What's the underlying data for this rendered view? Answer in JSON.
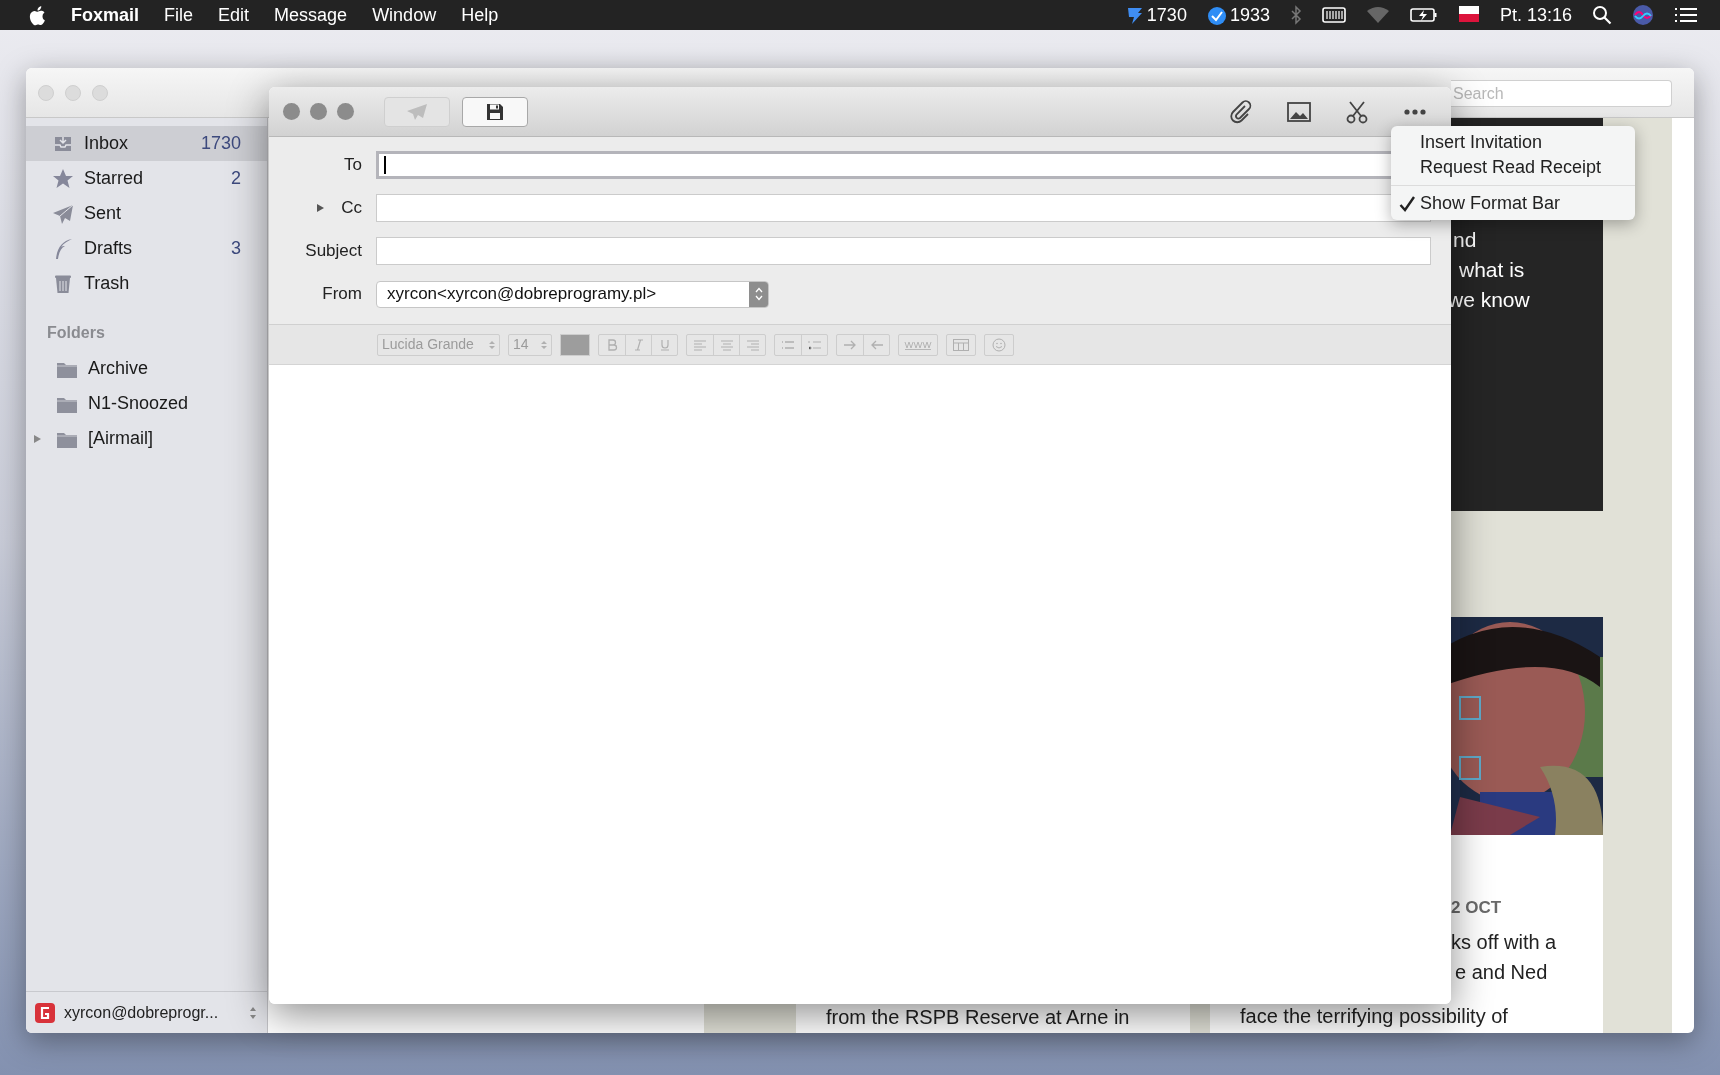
{
  "menu_bar": {
    "app": "Foxmail",
    "menus": [
      "File",
      "Edit",
      "Message",
      "Window",
      "Help"
    ],
    "counters": [
      "1730",
      "1933"
    ],
    "clock": "Pt. 13:16"
  },
  "main_window": {
    "search": {
      "placeholder": "Search"
    },
    "sidebar": {
      "mailboxes": [
        {
          "kind": "inbox",
          "label": "Inbox",
          "count": "1730",
          "selected": true
        },
        {
          "kind": "starred",
          "label": "Starred",
          "count": "2",
          "selected": false
        },
        {
          "kind": "sent",
          "label": "Sent",
          "selected": false
        },
        {
          "kind": "drafts",
          "label": "Drafts",
          "count": "3",
          "selected": false
        },
        {
          "kind": "trash",
          "label": "Trash",
          "selected": false
        }
      ],
      "folders_heading": "Folders",
      "folders": [
        {
          "label": "Archive",
          "expandable": false
        },
        {
          "label": "N1-Snoozed",
          "expandable": false
        },
        {
          "label": "[Airmail]",
          "expandable": true
        }
      ],
      "account": "xyrcon@dobreprogr..."
    },
    "reading_pane": {
      "column_1": {
        "lines": [
          "from the RSPB Reserve at Arne in"
        ]
      },
      "column_2": {
        "banner_lines": [
          "nd",
          "what is",
          "we know"
        ],
        "image": {
          "kind": "picture"
        },
        "date": "2 OCT",
        "lines": [
          "ks off with a",
          "e and Ned",
          "face the terrifying possibility of"
        ]
      }
    }
  },
  "compose": {
    "toolbar": {
      "send_disabled": true
    },
    "fields": [
      {
        "kind": "text",
        "label": "To",
        "focused": true,
        "expandable": false
      },
      {
        "kind": "text",
        "label": "Cc",
        "focused": false,
        "expandable": true
      },
      {
        "kind": "text",
        "label": "Subject",
        "focused": false,
        "expandable": false
      },
      {
        "kind": "select",
        "label": "From",
        "value": "xyrcon<xyrcon@dobreprogramy.pl>",
        "expandable": false
      }
    ],
    "format_bar": {
      "font": "Lucida Grande",
      "size": "14"
    },
    "more_menu": {
      "groups": [
        {
          "items": [
            {
              "label": "Insert Invitation",
              "checked": false
            },
            {
              "label": "Request Read Receipt",
              "checked": false
            }
          ]
        },
        {
          "items": [
            {
              "label": "Show Format Bar",
              "checked": true
            }
          ]
        }
      ]
    }
  }
}
